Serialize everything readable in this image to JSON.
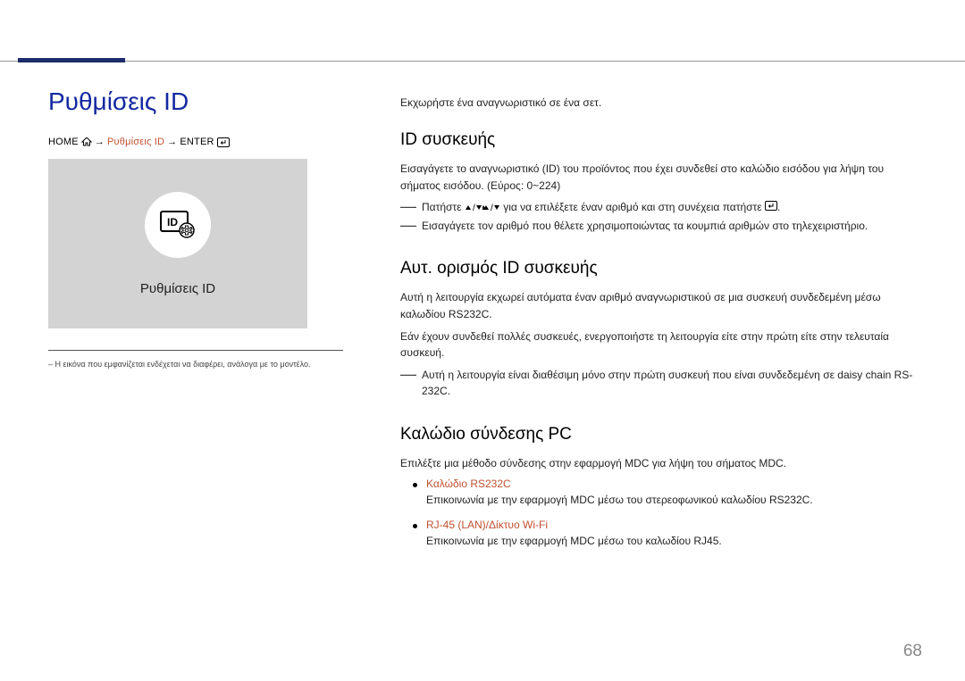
{
  "pageNumber": "68",
  "title": "Ρυθμίσεις ID",
  "breadcrumb": {
    "home": "HOME",
    "mid": "Ρυθμίσεις ID",
    "enter": "ENTER"
  },
  "screenshot": {
    "label": "Ρυθμίσεις ID"
  },
  "imageNote": "– Η εικόνα που εμφανίζεται ενδέχεται να διαφέρει, ανάλογα με το μοντέλο.",
  "intro": "Εκχωρήστε ένα αναγνωριστικό σε ένα σετ.",
  "sections": {
    "deviceId": {
      "title": "ID συσκευής",
      "body": "Εισαγάγετε το αναγνωριστικό (ID) του προϊόντος που έχει συνδεθεί στο καλώδιο εισόδου για λήψη του σήματος εισόδου. (Εύρος: 0~224)",
      "dash1a": "Πατήστε ",
      "dash1b": " για να επιλέξετε έναν αριθμό και στη συνέχεια πατήστε ",
      "dash1c": ".",
      "dash2": "Εισαγάγετε τον αριθμό που θέλετε χρησιμοποιώντας τα κουμπιά αριθμών στο τηλεχειριστήριο."
    },
    "autoId": {
      "title": "Αυτ. ορισμός ID συσκευής",
      "body1": "Αυτή η λειτουργία εκχωρεί αυτόματα έναν αριθμό αναγνωριστικού σε μια συσκευή συνδεδεμένη μέσω καλωδίου RS232C.",
      "body2": "Εάν έχουν συνδεθεί πολλές συσκευές, ενεργοποιήστε τη λειτουργία είτε στην πρώτη είτε στην τελευταία συσκευή.",
      "dash1": "Αυτή η λειτουργία είναι διαθέσιμη μόνο στην πρώτη συσκευή που είναι συνδεδεμένη σε daisy chain RS-232C."
    },
    "pcCable": {
      "title": "Καλώδιο σύνδεσης PC",
      "body": "Επιλέξτε μια μέθοδο σύνδεσης στην εφαρμογή MDC για λήψη του σήματος MDC.",
      "bullets": [
        {
          "title": "Καλώδιο RS232C",
          "desc": "Επικοινωνία με την εφαρμογή MDC μέσω του στερεοφωνικού καλωδίου RS232C."
        },
        {
          "title": "RJ-45 (LAN)/Δίκτυο Wi-Fi",
          "desc": "Επικοινωνία με την εφαρμογή MDC μέσω του καλωδίου RJ45."
        }
      ]
    }
  }
}
